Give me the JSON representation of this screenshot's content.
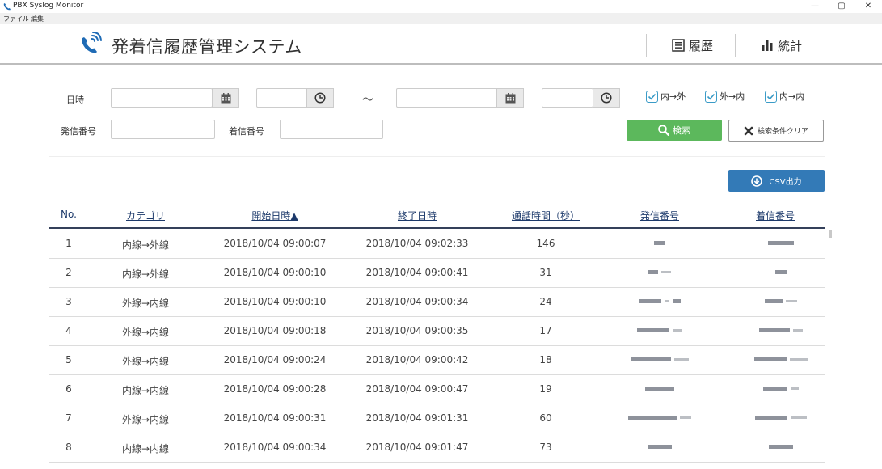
{
  "window": {
    "title": "PBX Syslog Monitor",
    "controls": {
      "minimize": "—",
      "maximize": "▢",
      "close": "✕"
    }
  },
  "menubar": {
    "items": [
      "ファイル",
      "編集"
    ]
  },
  "header": {
    "title": "発着信履歴管理システム",
    "nav": [
      {
        "label": "履歴",
        "icon": "list-icon"
      },
      {
        "label": "統計",
        "icon": "bar-chart-icon"
      }
    ]
  },
  "search": {
    "datetime_label": "日時",
    "range_separator": "～",
    "from_date": "",
    "from_time": "",
    "to_date": "",
    "to_time": "",
    "checkboxes": [
      {
        "label": "内→外",
        "checked": true
      },
      {
        "label": "外→内",
        "checked": true
      },
      {
        "label": "内→内",
        "checked": true
      }
    ],
    "caller_label": "発信番号",
    "caller_value": "",
    "callee_label": "着信番号",
    "callee_value": "",
    "search_button": "検索",
    "clear_button": "検索条件クリア",
    "csv_button": "CSV出力"
  },
  "table": {
    "columns": [
      "No.",
      "カテゴリ",
      "開始日時▲",
      "終了日時",
      "通話時間（秒）",
      "発信番号",
      "着信番号"
    ],
    "rows": [
      {
        "no": "1",
        "category": "内線→外線",
        "start": "2018/10/04  09:00:07",
        "end": "2018/10/04  09:02:33",
        "duration": "146"
      },
      {
        "no": "2",
        "category": "内線→外線",
        "start": "2018/10/04  09:00:10",
        "end": "2018/10/04  09:00:41",
        "duration": "31"
      },
      {
        "no": "3",
        "category": "外線→内線",
        "start": "2018/10/04  09:00:10",
        "end": "2018/10/04  09:00:34",
        "duration": "24"
      },
      {
        "no": "4",
        "category": "外線→内線",
        "start": "2018/10/04  09:00:18",
        "end": "2018/10/04  09:00:35",
        "duration": "17"
      },
      {
        "no": "5",
        "category": "外線→内線",
        "start": "2018/10/04  09:00:24",
        "end": "2018/10/04  09:00:42",
        "duration": "18"
      },
      {
        "no": "6",
        "category": "内線→内線",
        "start": "2018/10/04  09:00:28",
        "end": "2018/10/04  09:00:47",
        "duration": "19"
      },
      {
        "no": "7",
        "category": "外線→内線",
        "start": "2018/10/04  09:00:31",
        "end": "2018/10/04  09:01:31",
        "duration": "60"
      },
      {
        "no": "8",
        "category": "内線→内線",
        "start": "2018/10/04  09:00:34",
        "end": "2018/10/04  09:01:47",
        "duration": "73"
      }
    ]
  },
  "colors": {
    "search_button": "#5cb85c",
    "csv_button": "#337ab7",
    "header_text": "#1d3a6b",
    "checkbox": "#3a9bc7"
  }
}
